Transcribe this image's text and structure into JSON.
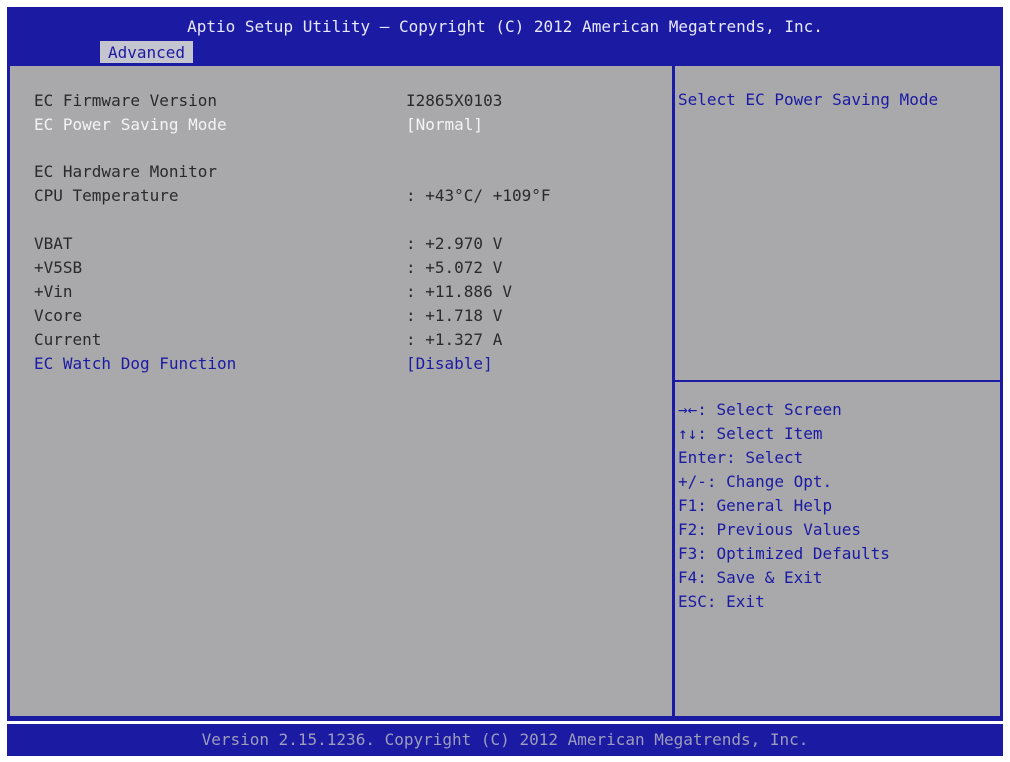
{
  "header": {
    "title": "Aptio Setup Utility – Copyright (C) 2012 American Megatrends, Inc.",
    "tab": "Advanced"
  },
  "main": {
    "rows": [
      {
        "label": "EC Firmware Version",
        "value": "I2865X0103"
      },
      {
        "label": "EC Power Saving Mode",
        "value": "[Normal]"
      },
      {
        "label": "EC Hardware Monitor",
        "value": ""
      },
      {
        "label": "CPU Temperature",
        "value": ": +43°C/ +109°F"
      },
      {
        "label": "VBAT",
        "value": ": +2.970 V"
      },
      {
        "label": "+V5SB",
        "value": ": +5.072 V"
      },
      {
        "label": "+Vin",
        "value": ": +11.886 V"
      },
      {
        "label": "Vcore",
        "value": ": +1.718 V"
      },
      {
        "label": "Current",
        "value": ": +1.327 A"
      },
      {
        "label": "EC Watch Dog Function",
        "value": "[Disable]"
      }
    ]
  },
  "side": {
    "help": "Select EC Power Saving Mode",
    "keys": [
      "→←: Select Screen",
      "↑↓: Select Item",
      "Enter: Select",
      "+/-: Change Opt.",
      "F1: General Help",
      "F2: Previous Values",
      "F3: Optimized Defaults",
      "F4: Save & Exit",
      "ESC: Exit"
    ]
  },
  "footer": {
    "text": "Version 2.15.1236. Copyright (C) 2012 American Megatrends, Inc."
  },
  "colors": {
    "frame_blue": "#1b1aa3",
    "panel_gray": "#a9a9ab",
    "selected_text": "#f4f4f4"
  }
}
